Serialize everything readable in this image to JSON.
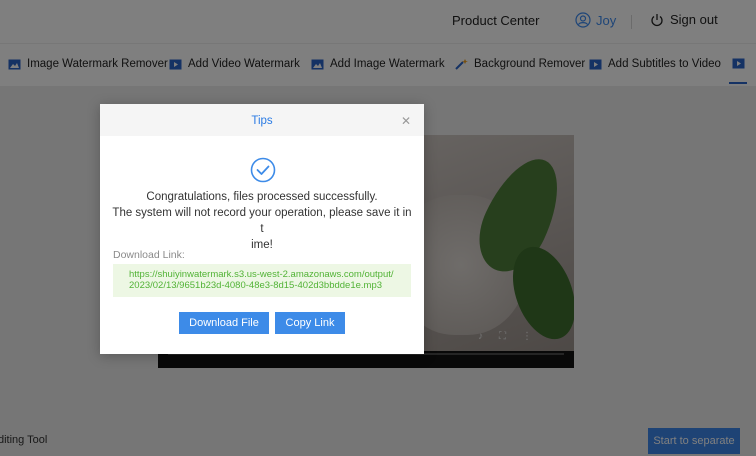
{
  "header": {
    "product_center": "Product Center",
    "user_name": "Joy",
    "sign_out": "Sign out"
  },
  "toolnav": {
    "items": [
      {
        "label": "Image Watermark Remover",
        "icon": "image-icon"
      },
      {
        "label": "Add Video Watermark",
        "icon": "video-icon"
      },
      {
        "label": "Add Image Watermark",
        "icon": "image-icon"
      },
      {
        "label": "Background Remover",
        "icon": "magic-wand-icon"
      },
      {
        "label": "Add Subtitles to Video",
        "icon": "video-icon"
      },
      {
        "label": "",
        "icon": "video-icon"
      }
    ]
  },
  "bottom": {
    "label": "diting Tool",
    "start_button": "Start to separate"
  },
  "modal": {
    "title": "Tips",
    "close_icon": "close-icon",
    "status_icon": "check-circle-icon",
    "message_line1": "Congratulations, files processed successfully.",
    "message_line2": "The system will not record your operation, please save it in t",
    "message_line3": "ime!",
    "download_label": "Download Link:",
    "download_url": "https://shuiyinwatermark.s3.us-west-2.amazonaws.com/output/2023/02/13/9651b23d-4080-48e3-8d15-402d3bbdde1e.mp3",
    "download_button": "Download File",
    "copy_button": "Copy Link"
  },
  "colors": {
    "accent": "#3d8be8",
    "link_green": "#52b336",
    "link_bg": "#edf7e4"
  }
}
